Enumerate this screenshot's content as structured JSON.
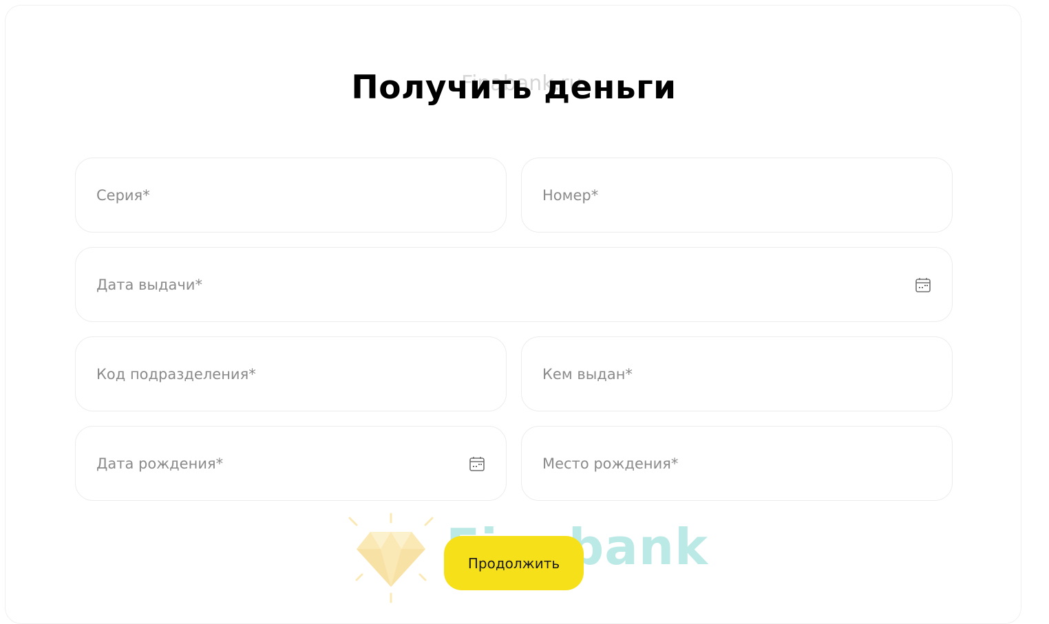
{
  "page": {
    "title": "Получить деньги",
    "watermark_text": "Finabank.ru",
    "watermark_brand": "Finabank"
  },
  "form": {
    "fields": {
      "series": {
        "placeholder": "Серия*",
        "value": ""
      },
      "number": {
        "placeholder": "Номер*",
        "value": ""
      },
      "issue_date": {
        "placeholder": "Дата выдачи*",
        "value": "",
        "icon": "calendar-icon"
      },
      "department_code": {
        "placeholder": "Код подразделения*",
        "value": ""
      },
      "issued_by": {
        "placeholder": "Кем выдан*",
        "value": ""
      },
      "birth_date": {
        "placeholder": "Дата рождения*",
        "value": "",
        "icon": "calendar-icon"
      },
      "birth_place": {
        "placeholder": "Место рождения*",
        "value": ""
      }
    },
    "submit_label": "Продолжить"
  },
  "colors": {
    "accent": "#f6e01a",
    "field_border": "#ececec",
    "placeholder": "#8a8a8a",
    "watermark_teal": "#9ee0dc",
    "watermark_gold": "#f8d879"
  }
}
